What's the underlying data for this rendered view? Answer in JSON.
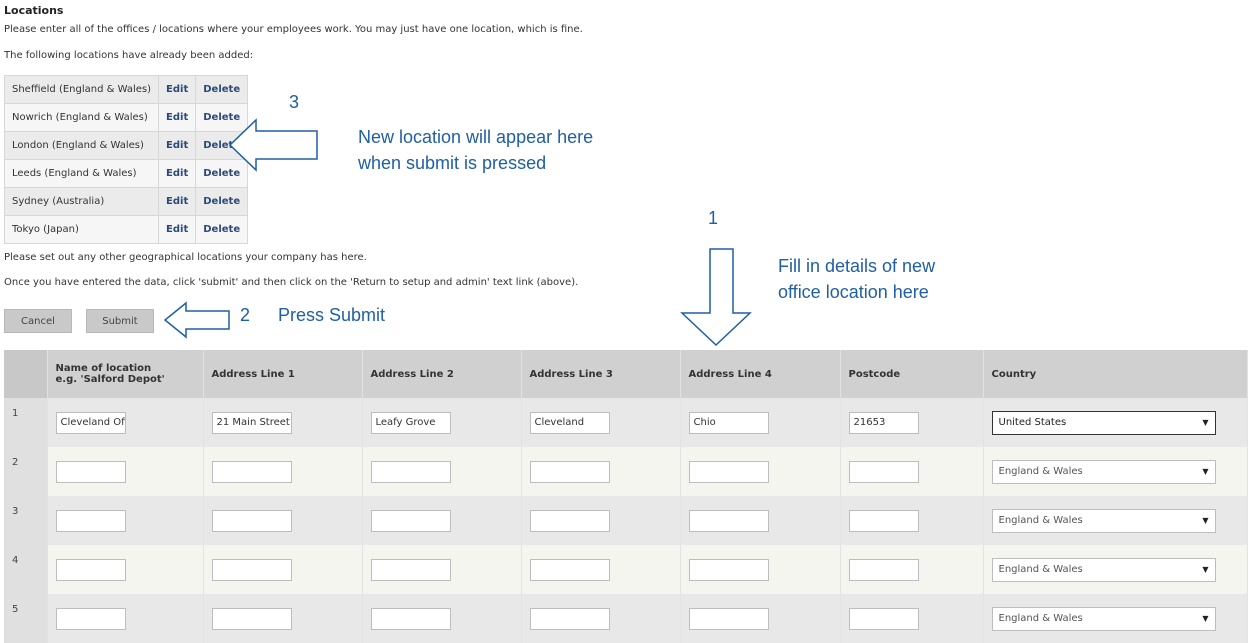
{
  "page": {
    "title": "Locations",
    "intro": "Please enter all of the offices / locations where your employees work. You may just have one location, which is fine.",
    "added_intro": "The following locations have already been added:",
    "geo_note": "Please set out any other geographical locations your company has here.",
    "instructions": "Once you have entered the data, click 'submit' and then click on the 'Return to setup and admin' text link (above)."
  },
  "existing_locations": [
    {
      "name": "Sheffield (England & Wales)",
      "edit": "Edit",
      "delete": "Delete"
    },
    {
      "name": "Nowrich (England & Wales)",
      "edit": "Edit",
      "delete": "Delete"
    },
    {
      "name": "London (England & Wales)",
      "edit": "Edit",
      "delete": "Delete"
    },
    {
      "name": "Leeds (England & Wales)",
      "edit": "Edit",
      "delete": "Delete"
    },
    {
      "name": "Sydney (Australia)",
      "edit": "Edit",
      "delete": "Delete"
    },
    {
      "name": "Tokyo (Japan)",
      "edit": "Edit",
      "delete": "Delete"
    }
  ],
  "buttons": {
    "cancel": "Cancel",
    "submit": "Submit"
  },
  "annotations": {
    "step1_num": "1",
    "step1_line1": "Fill in details of new",
    "step1_line2": "office location here",
    "step2_num": "2",
    "step2_text": "Press Submit",
    "step3_num": "3",
    "step3_line1": "New location will appear here",
    "step3_line2": "when submit is pressed",
    "color": "#1f5fa3"
  },
  "grid": {
    "headers": {
      "name_line1": "Name of location",
      "name_line2": "e.g. 'Salford Depot'",
      "addr1": "Address Line 1",
      "addr2": "Address Line 2",
      "addr3": "Address Line 3",
      "addr4": "Address Line 4",
      "postcode": "Postcode",
      "country": "Country"
    },
    "rows": [
      {
        "num": "1",
        "name": "Cleveland Offi",
        "addr1": "21 Main Street",
        "addr2": "Leafy Grove",
        "addr3": "Cleveland",
        "addr4": "Chio",
        "postcode": "21653",
        "country": "United States"
      },
      {
        "num": "2",
        "name": "",
        "addr1": "",
        "addr2": "",
        "addr3": "",
        "addr4": "",
        "postcode": "",
        "country": "England & Wales"
      },
      {
        "num": "3",
        "name": "",
        "addr1": "",
        "addr2": "",
        "addr3": "",
        "addr4": "",
        "postcode": "",
        "country": "England & Wales"
      },
      {
        "num": "4",
        "name": "",
        "addr1": "",
        "addr2": "",
        "addr3": "",
        "addr4": "",
        "postcode": "",
        "country": "England & Wales"
      },
      {
        "num": "5",
        "name": "",
        "addr1": "",
        "addr2": "",
        "addr3": "",
        "addr4": "",
        "postcode": "",
        "country": "England & Wales"
      }
    ]
  }
}
